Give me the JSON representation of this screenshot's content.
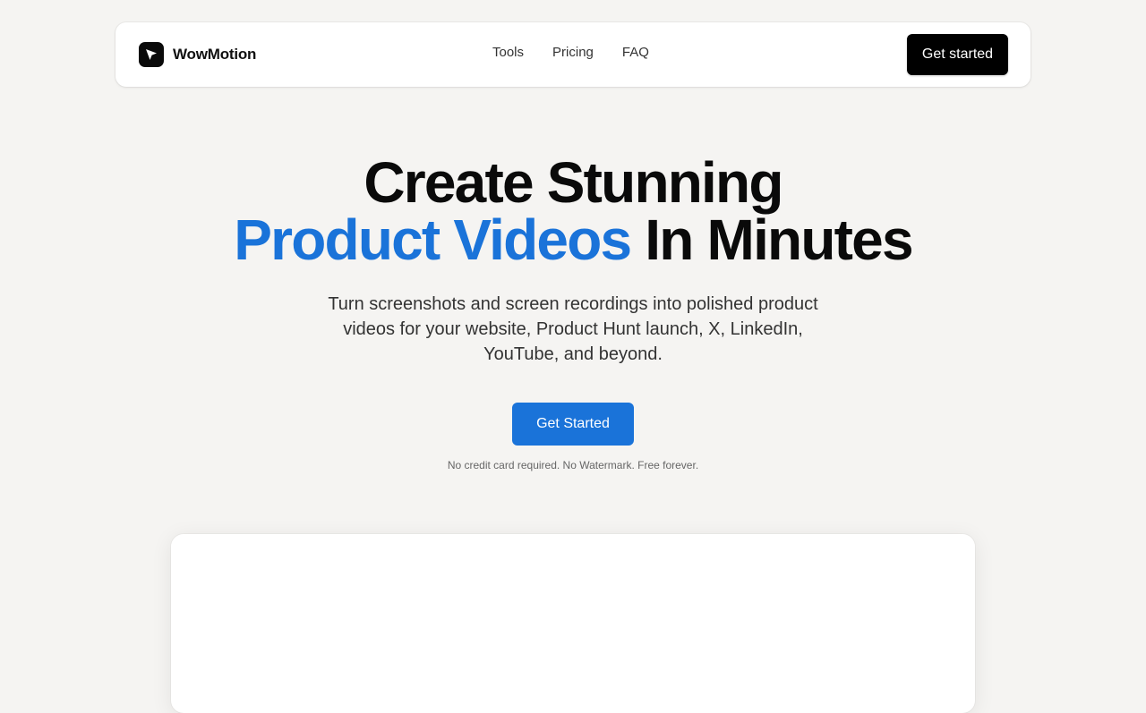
{
  "brand": {
    "name": "WowMotion",
    "logo_icon": "cursor-arrow-icon"
  },
  "nav": {
    "links": [
      "Tools",
      "Pricing",
      "FAQ"
    ],
    "cta_label": "Get started"
  },
  "hero": {
    "title_line1": "Create Stunning",
    "title_accent": "Product Videos",
    "title_rest": " In Minutes",
    "subtitle": "Turn screenshots and screen recordings into polished product videos for your website, Product Hunt launch, X, LinkedIn, YouTube, and beyond.",
    "cta_label": "Get Started",
    "note": "No credit card required. No Watermark. Free forever."
  },
  "colors": {
    "background": "#f5f4f2",
    "accent": "#1a73d9",
    "dark": "#000000"
  }
}
